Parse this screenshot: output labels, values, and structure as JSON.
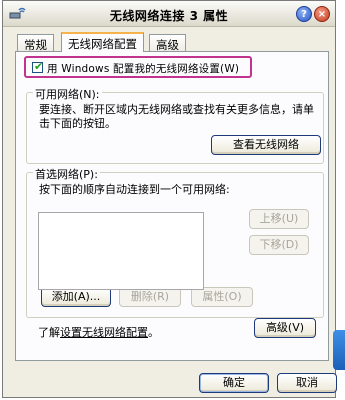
{
  "window": {
    "title": "无线网络连接 3 属性",
    "help_glyph": "?",
    "close_glyph": "×"
  },
  "tabs": [
    {
      "label": "常规",
      "active": false
    },
    {
      "label": "无线网络配置",
      "active": true
    },
    {
      "label": "高级",
      "active": false
    }
  ],
  "use_windows_config": {
    "checked": true,
    "label": "用 Windows 配置我的无线网络设置(W)"
  },
  "available_networks": {
    "title": "可用网络(N):",
    "description": "要连接、断开区域内无线网络或查找有关更多信息，请单击下面的按钮。",
    "view_button": "查看无线网络"
  },
  "preferred_networks": {
    "title": "首选网络(P):",
    "description": "按下面的顺序自动连接到一个可用网络:",
    "items": [],
    "move_up_button": "上移(U)",
    "move_down_button": "下移(D)",
    "add_button": "添加(A)...",
    "remove_button": "删除(R)",
    "properties_button": "属性(O)"
  },
  "learn_more": {
    "prefix": "了解",
    "link": "设置无线网络配置",
    "suffix": "。",
    "advanced_button": "高级(V)"
  },
  "footer": {
    "ok_button": "确定",
    "cancel_button": "取消"
  },
  "colors": {
    "highlight_frame": "#c0338e",
    "active_tab_accent": "#f7b24b",
    "button_border": "#1e3a7a"
  }
}
